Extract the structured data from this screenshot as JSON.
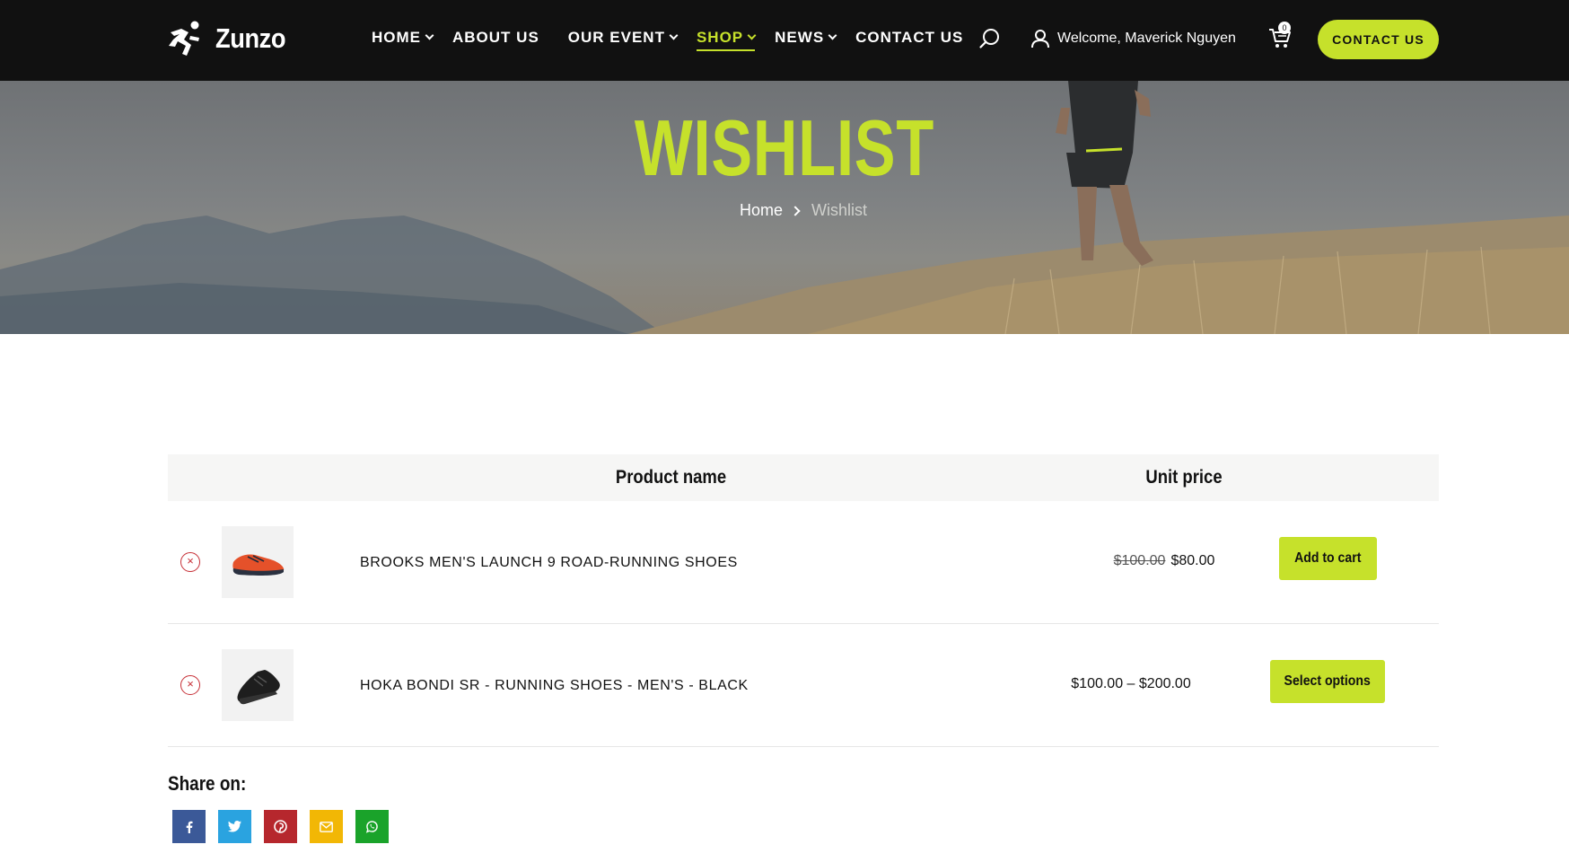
{
  "brand": {
    "name": "Zunzo",
    "accent": "#c6e12b"
  },
  "nav": {
    "items": [
      {
        "label": "HOME",
        "dropdown": true,
        "active": false
      },
      {
        "label": "ABOUT US",
        "dropdown": false,
        "active": false
      },
      {
        "label": "OUR EVENT",
        "dropdown": true,
        "active": false
      },
      {
        "label": "SHOP",
        "dropdown": true,
        "active": true
      },
      {
        "label": "NEWS",
        "dropdown": true,
        "active": false
      },
      {
        "label": "CONTACT US",
        "dropdown": false,
        "active": false
      }
    ],
    "welcome": "Welcome, Maverick Nguyen",
    "cart_count": "0",
    "contact_button": "CONTACT US"
  },
  "hero": {
    "title": "WISHLIST",
    "breadcrumb": {
      "home": "Home",
      "current": "Wishlist"
    }
  },
  "table": {
    "headers": {
      "name": "Product name",
      "price": "Unit price"
    },
    "rows": [
      {
        "name": "BROOKS MEN'S LAUNCH 9 ROAD-RUNNING SHOES",
        "old_price": "$100.00",
        "price": "$80.00",
        "action": "Add to cart",
        "thumb_icon": "orange-shoe-image",
        "remove_symbol": "×"
      },
      {
        "name": "HOKA BONDI SR - RUNNING SHOES - MEN'S - BLACK",
        "price_range": "$100.00 – $200.00",
        "action": "Select options",
        "thumb_icon": "black-shoe-image",
        "remove_symbol": "×"
      }
    ]
  },
  "share": {
    "label": "Share on:",
    "networks": [
      {
        "name": "facebook-icon",
        "color": "#3b5998"
      },
      {
        "name": "twitter-icon",
        "color": "#2aa3e0"
      },
      {
        "name": "pinterest-icon",
        "color": "#b6272d"
      },
      {
        "name": "email-icon",
        "color": "#f2b705"
      },
      {
        "name": "whatsapp-icon",
        "color": "#1aa32a"
      }
    ]
  }
}
